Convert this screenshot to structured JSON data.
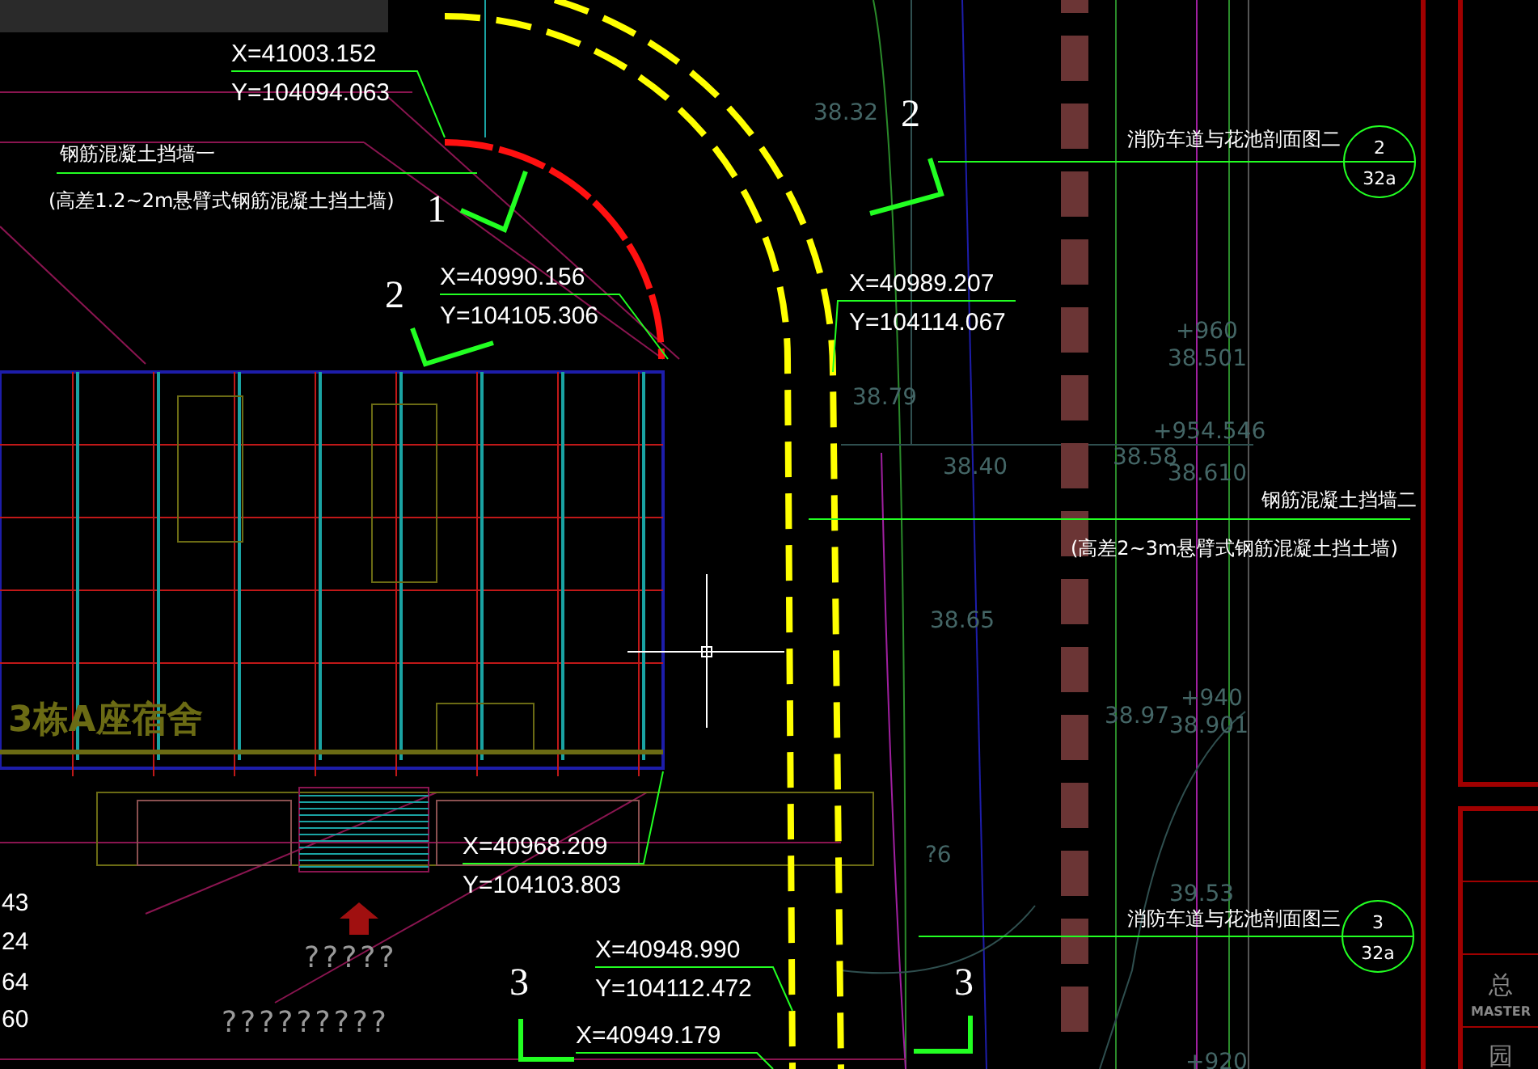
{
  "coordinate_labels": [
    {
      "x": "X=41003.152",
      "y": "Y=104094.063"
    },
    {
      "x": "X=40990.156",
      "y": "Y=104105.306"
    },
    {
      "x": "X=40989.207",
      "y": "Y=104114.067"
    },
    {
      "x": "X=40968.209",
      "y": "Y=104103.803"
    },
    {
      "x": "X=40948.990",
      "y": "Y=104112.472"
    },
    {
      "x": "X=40949.179"
    }
  ],
  "wall_notes": [
    {
      "title": "钢筋混凝土挡墙一",
      "detail": "(高差1.2~2m悬臂式钢筋混凝土挡土墙)"
    },
    {
      "title": "钢筋混凝土挡墙二",
      "detail": "(高差2~3m悬臂式钢筋混凝土挡土墙)"
    }
  ],
  "section_marks": [
    "1",
    "2",
    "2",
    "3",
    "3"
  ],
  "section_callouts": [
    {
      "title": "消防车道与花池剖面图二",
      "number": "2",
      "sheet": "32a"
    },
    {
      "title": "消防车道与花池剖面图三",
      "number": "3",
      "sheet": "32a"
    }
  ],
  "building_label": "3栋A座宿舍",
  "elevations": [
    "38.32",
    "+960",
    "38.501",
    "38.79",
    "+954.546",
    "38.58",
    "38.40",
    "38.610",
    "38.65",
    "+940",
    "38.97",
    "38.901",
    "?6",
    "39.53",
    "+920"
  ],
  "left_numbers": [
    "43",
    "24",
    "64",
    "60"
  ],
  "question_marks": [
    "?????",
    "?????????"
  ],
  "title_block": {
    "title": "总",
    "subtitle": "MASTER",
    "next": "园"
  }
}
